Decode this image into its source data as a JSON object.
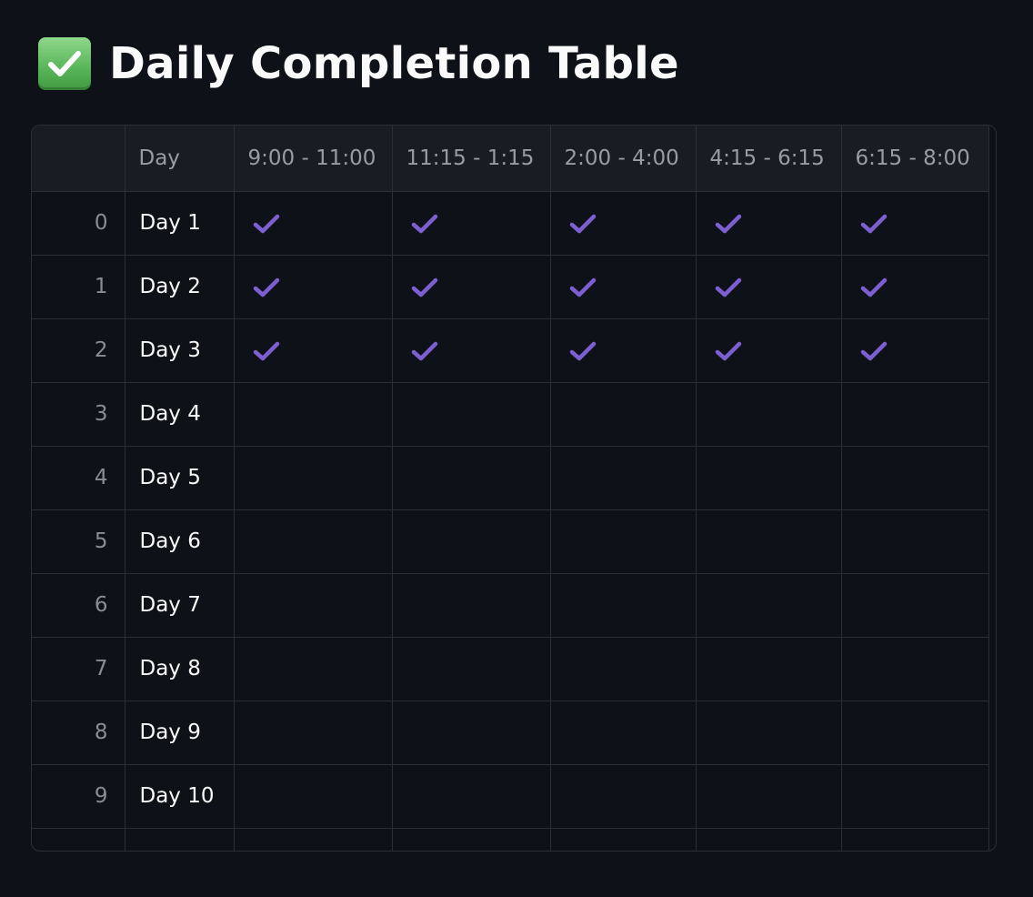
{
  "title": {
    "icon": "green-check-box-icon",
    "text": "Daily Completion Table"
  },
  "table": {
    "columns": [
      "",
      "Day",
      "9:00 - 11:00",
      "11:15 - 1:15",
      "2:00 - 4:00",
      "4:15 - 6:15",
      "6:15 - 8:00"
    ],
    "rows": [
      {
        "index": "0",
        "day": "Day 1",
        "slots": [
          true,
          true,
          true,
          true,
          true
        ]
      },
      {
        "index": "1",
        "day": "Day 2",
        "slots": [
          true,
          true,
          true,
          true,
          true
        ]
      },
      {
        "index": "2",
        "day": "Day 3",
        "slots": [
          true,
          true,
          true,
          true,
          true
        ]
      },
      {
        "index": "3",
        "day": "Day 4",
        "slots": [
          false,
          false,
          false,
          false,
          false
        ]
      },
      {
        "index": "4",
        "day": "Day 5",
        "slots": [
          false,
          false,
          false,
          false,
          false
        ]
      },
      {
        "index": "5",
        "day": "Day 6",
        "slots": [
          false,
          false,
          false,
          false,
          false
        ]
      },
      {
        "index": "6",
        "day": "Day 7",
        "slots": [
          false,
          false,
          false,
          false,
          false
        ]
      },
      {
        "index": "7",
        "day": "Day 8",
        "slots": [
          false,
          false,
          false,
          false,
          false
        ]
      },
      {
        "index": "8",
        "day": "Day 9",
        "slots": [
          false,
          false,
          false,
          false,
          false
        ]
      },
      {
        "index": "9",
        "day": "Day 10",
        "slots": [
          false,
          false,
          false,
          false,
          false
        ]
      }
    ],
    "check_color": "#7c5fd0"
  },
  "colors": {
    "background": "#0e1117",
    "header_background": "#1a1c23",
    "grid_line": "#2c2f37",
    "text": "#fafafa",
    "muted_text": "#9a9ca3"
  }
}
